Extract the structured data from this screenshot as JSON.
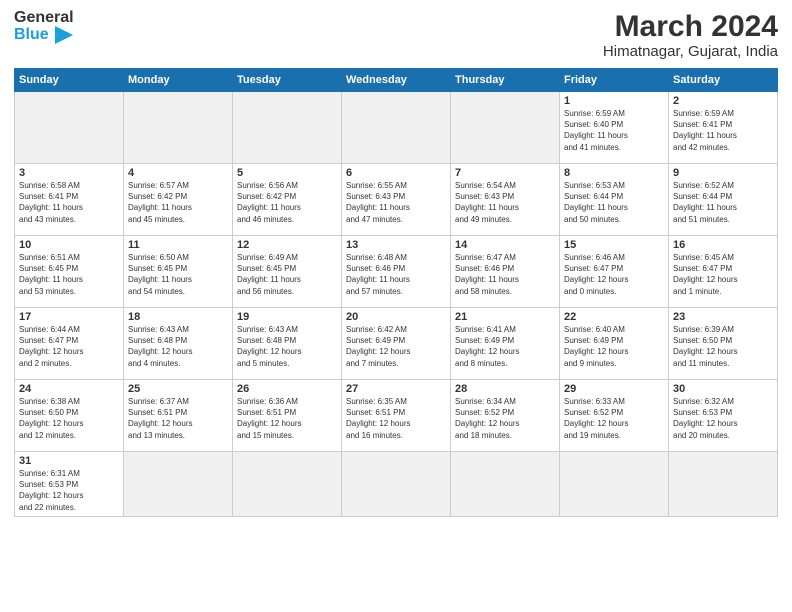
{
  "header": {
    "logo_general": "General",
    "logo_blue": "Blue",
    "month_year": "March 2024",
    "location": "Himatnagar, Gujarat, India"
  },
  "days_of_week": [
    "Sunday",
    "Monday",
    "Tuesday",
    "Wednesday",
    "Thursday",
    "Friday",
    "Saturday"
  ],
  "weeks": [
    [
      {
        "day": "",
        "info": ""
      },
      {
        "day": "",
        "info": ""
      },
      {
        "day": "",
        "info": ""
      },
      {
        "day": "",
        "info": ""
      },
      {
        "day": "",
        "info": ""
      },
      {
        "day": "1",
        "info": "Sunrise: 6:59 AM\nSunset: 6:40 PM\nDaylight: 11 hours\nand 41 minutes."
      },
      {
        "day": "2",
        "info": "Sunrise: 6:59 AM\nSunset: 6:41 PM\nDaylight: 11 hours\nand 42 minutes."
      }
    ],
    [
      {
        "day": "3",
        "info": "Sunrise: 6:58 AM\nSunset: 6:41 PM\nDaylight: 11 hours\nand 43 minutes."
      },
      {
        "day": "4",
        "info": "Sunrise: 6:57 AM\nSunset: 6:42 PM\nDaylight: 11 hours\nand 45 minutes."
      },
      {
        "day": "5",
        "info": "Sunrise: 6:56 AM\nSunset: 6:42 PM\nDaylight: 11 hours\nand 46 minutes."
      },
      {
        "day": "6",
        "info": "Sunrise: 6:55 AM\nSunset: 6:43 PM\nDaylight: 11 hours\nand 47 minutes."
      },
      {
        "day": "7",
        "info": "Sunrise: 6:54 AM\nSunset: 6:43 PM\nDaylight: 11 hours\nand 49 minutes."
      },
      {
        "day": "8",
        "info": "Sunrise: 6:53 AM\nSunset: 6:44 PM\nDaylight: 11 hours\nand 50 minutes."
      },
      {
        "day": "9",
        "info": "Sunrise: 6:52 AM\nSunset: 6:44 PM\nDaylight: 11 hours\nand 51 minutes."
      }
    ],
    [
      {
        "day": "10",
        "info": "Sunrise: 6:51 AM\nSunset: 6:45 PM\nDaylight: 11 hours\nand 53 minutes."
      },
      {
        "day": "11",
        "info": "Sunrise: 6:50 AM\nSunset: 6:45 PM\nDaylight: 11 hours\nand 54 minutes."
      },
      {
        "day": "12",
        "info": "Sunrise: 6:49 AM\nSunset: 6:45 PM\nDaylight: 11 hours\nand 56 minutes."
      },
      {
        "day": "13",
        "info": "Sunrise: 6:48 AM\nSunset: 6:46 PM\nDaylight: 11 hours\nand 57 minutes."
      },
      {
        "day": "14",
        "info": "Sunrise: 6:47 AM\nSunset: 6:46 PM\nDaylight: 11 hours\nand 58 minutes."
      },
      {
        "day": "15",
        "info": "Sunrise: 6:46 AM\nSunset: 6:47 PM\nDaylight: 12 hours\nand 0 minutes."
      },
      {
        "day": "16",
        "info": "Sunrise: 6:45 AM\nSunset: 6:47 PM\nDaylight: 12 hours\nand 1 minute."
      }
    ],
    [
      {
        "day": "17",
        "info": "Sunrise: 6:44 AM\nSunset: 6:47 PM\nDaylight: 12 hours\nand 2 minutes."
      },
      {
        "day": "18",
        "info": "Sunrise: 6:43 AM\nSunset: 6:48 PM\nDaylight: 12 hours\nand 4 minutes."
      },
      {
        "day": "19",
        "info": "Sunrise: 6:43 AM\nSunset: 6:48 PM\nDaylight: 12 hours\nand 5 minutes."
      },
      {
        "day": "20",
        "info": "Sunrise: 6:42 AM\nSunset: 6:49 PM\nDaylight: 12 hours\nand 7 minutes."
      },
      {
        "day": "21",
        "info": "Sunrise: 6:41 AM\nSunset: 6:49 PM\nDaylight: 12 hours\nand 8 minutes."
      },
      {
        "day": "22",
        "info": "Sunrise: 6:40 AM\nSunset: 6:49 PM\nDaylight: 12 hours\nand 9 minutes."
      },
      {
        "day": "23",
        "info": "Sunrise: 6:39 AM\nSunset: 6:50 PM\nDaylight: 12 hours\nand 11 minutes."
      }
    ],
    [
      {
        "day": "24",
        "info": "Sunrise: 6:38 AM\nSunset: 6:50 PM\nDaylight: 12 hours\nand 12 minutes."
      },
      {
        "day": "25",
        "info": "Sunrise: 6:37 AM\nSunset: 6:51 PM\nDaylight: 12 hours\nand 13 minutes."
      },
      {
        "day": "26",
        "info": "Sunrise: 6:36 AM\nSunset: 6:51 PM\nDaylight: 12 hours\nand 15 minutes."
      },
      {
        "day": "27",
        "info": "Sunrise: 6:35 AM\nSunset: 6:51 PM\nDaylight: 12 hours\nand 16 minutes."
      },
      {
        "day": "28",
        "info": "Sunrise: 6:34 AM\nSunset: 6:52 PM\nDaylight: 12 hours\nand 18 minutes."
      },
      {
        "day": "29",
        "info": "Sunrise: 6:33 AM\nSunset: 6:52 PM\nDaylight: 12 hours\nand 19 minutes."
      },
      {
        "day": "30",
        "info": "Sunrise: 6:32 AM\nSunset: 6:53 PM\nDaylight: 12 hours\nand 20 minutes."
      }
    ],
    [
      {
        "day": "31",
        "info": "Sunrise: 6:31 AM\nSunset: 6:53 PM\nDaylight: 12 hours\nand 22 minutes."
      },
      {
        "day": "",
        "info": ""
      },
      {
        "day": "",
        "info": ""
      },
      {
        "day": "",
        "info": ""
      },
      {
        "day": "",
        "info": ""
      },
      {
        "day": "",
        "info": ""
      },
      {
        "day": "",
        "info": ""
      }
    ]
  ],
  "colors": {
    "header_bg": "#1a6faf",
    "logo_blue": "#1a9fdf"
  }
}
